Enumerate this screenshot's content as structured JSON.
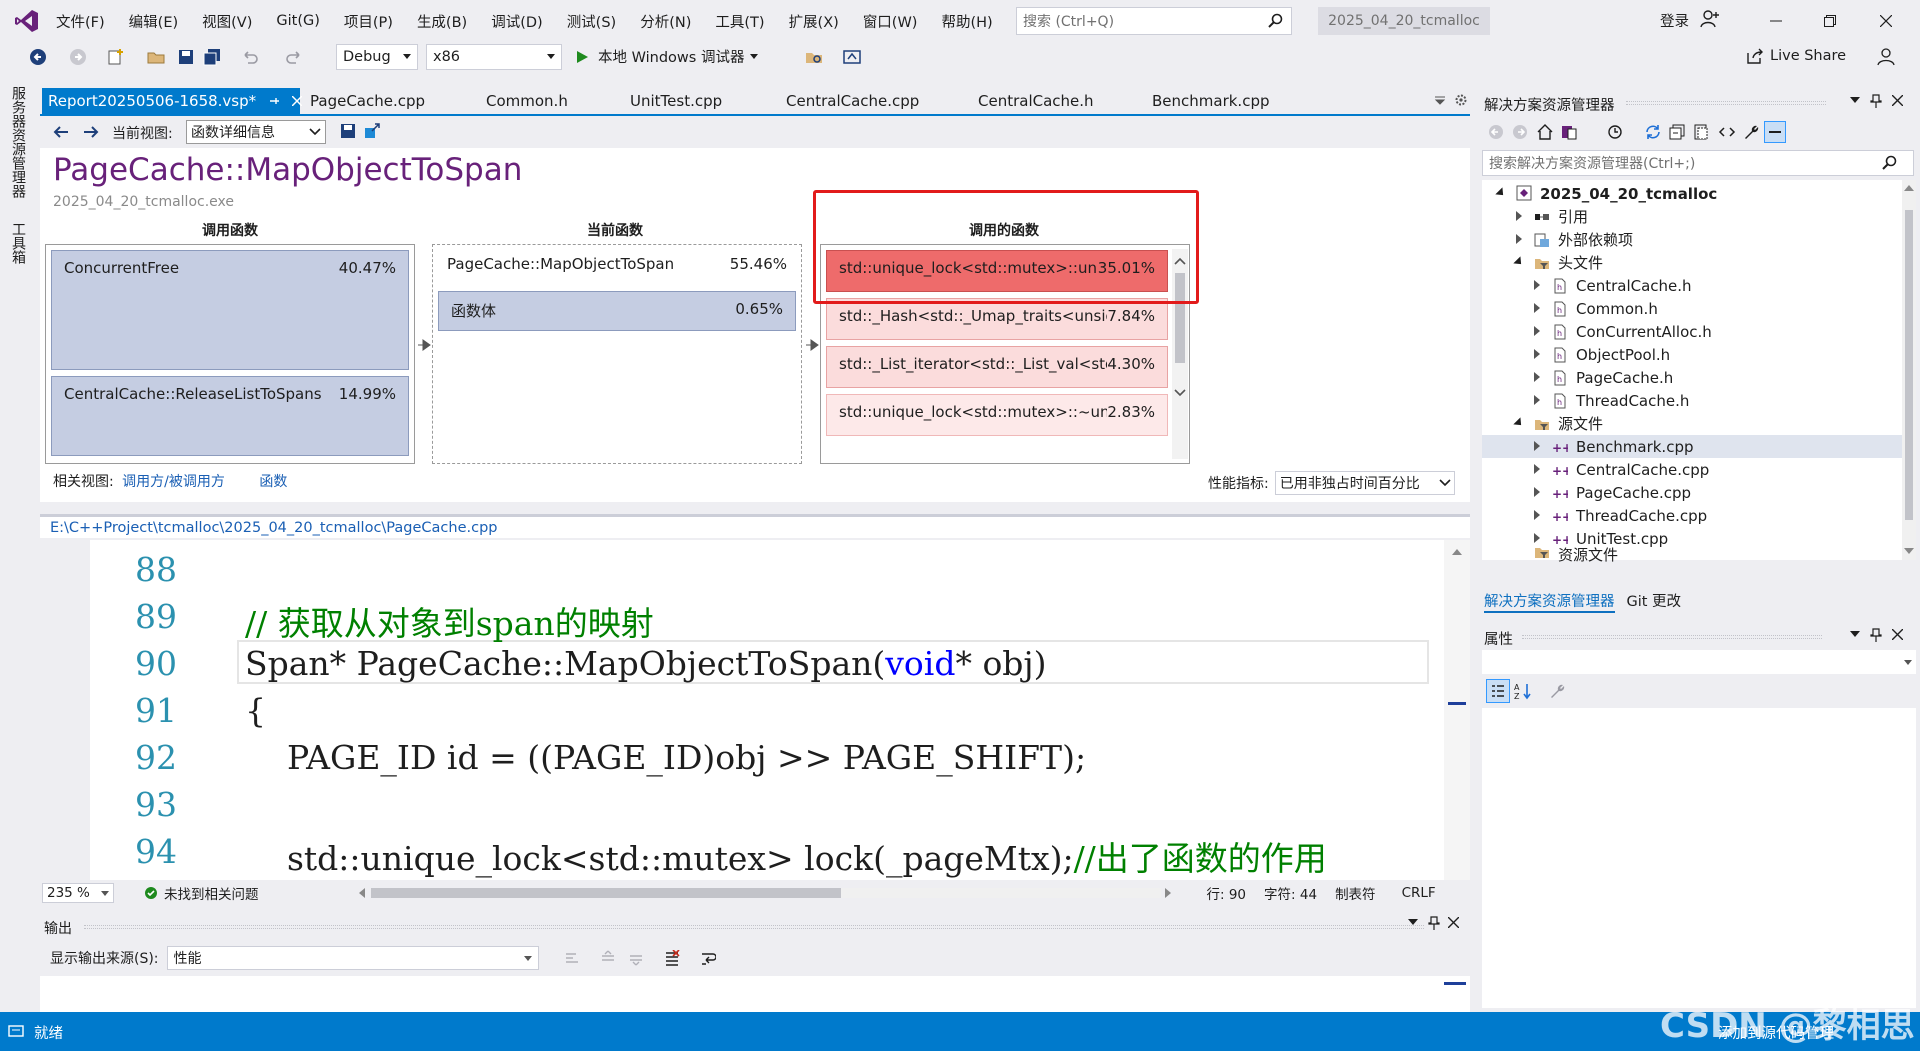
{
  "menubar": {
    "items": [
      "文件(F)",
      "编辑(E)",
      "视图(V)",
      "Git(G)",
      "项目(P)",
      "生成(B)",
      "调试(D)",
      "测试(S)",
      "分析(N)",
      "工具(T)",
      "扩展(X)",
      "窗口(W)",
      "帮助(H)"
    ],
    "search_placeholder": "搜索 (Ctrl+Q)",
    "solution_name": "2025_04_20_tcmalloc",
    "login": "登录"
  },
  "toolbar": {
    "config": "Debug",
    "platform": "x86",
    "debugger": "本地 Windows 调试器",
    "live_share": "Live Share"
  },
  "left_tabs": [
    "服务器资源管理器",
    "工具箱"
  ],
  "doc_tabs": [
    {
      "label": "Report20250506-1658.vsp*",
      "active": true
    },
    {
      "label": "PageCache.cpp"
    },
    {
      "label": "Common.h"
    },
    {
      "label": "UnitTest.cpp"
    },
    {
      "label": "CentralCache.cpp"
    },
    {
      "label": "CentralCache.h"
    },
    {
      "label": "Benchmark.cpp"
    }
  ],
  "report": {
    "current_view_label": "当前视图:",
    "current_view_value": "函数详细信息",
    "title": "PageCache::MapObjectToSpan",
    "exe": "2025_04_20_tcmalloc.exe",
    "callers_header": "调用函数",
    "current_header": "当前函数",
    "callees_header": "调用的函数",
    "callers": [
      {
        "name": "ConcurrentFree",
        "pct": "40.47%"
      },
      {
        "name": "CentralCache::ReleaseListToSpans",
        "pct": "14.99%"
      }
    ],
    "current": [
      {
        "name": "PageCache::MapObjectToSpan",
        "pct": "55.46%"
      },
      {
        "name": "函数体",
        "pct": "0.65%"
      }
    ],
    "callees": [
      {
        "name": "std::unique_lock<std::mutex>::unique_lock<s...",
        "pct": "35.01%"
      },
      {
        "name": "std::_Hash<std::_Umap_traits<unsigned int,Sp...",
        "pct": "7.84%"
      },
      {
        "name": "std::_List_iterator<std::_List_val<std::_List_simpl...",
        "pct": "4.30%"
      },
      {
        "name": "std::unique_lock<std::mutex>::~unique_lock<s...",
        "pct": "2.83%"
      }
    ],
    "related_label": "相关视图:",
    "related_link1": "调用方/被调用方",
    "related_link2": "函数",
    "metric_label": "性能指标:",
    "metric_value": "已用非独占时间百分比"
  },
  "editor": {
    "path": "E:\\C++Project\\tcmalloc\\2025_04_20_tcmalloc\\PageCache.cpp",
    "lines": [
      {
        "no": "88",
        "code": ""
      },
      {
        "no": "89",
        "code": "// 获取从对象到span的映射"
      },
      {
        "no": "90",
        "code_a": "Span* PageCache::MapObjectToSpan(",
        "code_kw": "void",
        "code_b": "* obj)"
      },
      {
        "no": "91",
        "code": "{"
      },
      {
        "no": "92",
        "code": "    PAGE_ID id = ((PAGE_ID)obj >> PAGE_SHIFT);"
      },
      {
        "no": "93",
        "code": ""
      },
      {
        "no": "94",
        "code_a": "    std::unique_lock<std::mutex> lock(_pageMtx);",
        "code_cm": "//出了函数的作用"
      }
    ],
    "zoom": "235 %",
    "issues": "未找到相关问题",
    "row": "行: 90",
    "col": "字符: 44",
    "tabs": "制表符",
    "eol": "CRLF"
  },
  "output": {
    "title": "输出",
    "source_label": "显示输出来源(S):",
    "source_value": "性能"
  },
  "solution_explorer": {
    "title": "解决方案资源管理器",
    "search_placeholder": "搜索解决方案资源管理器(Ctrl+;)",
    "root": "2025_04_20_tcmalloc",
    "nodes": [
      {
        "label": "引用",
        "level": 1
      },
      {
        "label": "外部依赖项",
        "level": 1
      },
      {
        "label": "头文件",
        "level": 1
      },
      {
        "label": "CentralCache.h",
        "level": 2
      },
      {
        "label": "Common.h",
        "level": 2
      },
      {
        "label": "ConCurrentAlloc.h",
        "level": 2
      },
      {
        "label": "ObjectPool.h",
        "level": 2
      },
      {
        "label": "PageCache.h",
        "level": 2
      },
      {
        "label": "ThreadCache.h",
        "level": 2
      },
      {
        "label": "源文件",
        "level": 1
      },
      {
        "label": "Benchmark.cpp",
        "level": 2
      },
      {
        "label": "CentralCache.cpp",
        "level": 2
      },
      {
        "label": "PageCache.cpp",
        "level": 2
      },
      {
        "label": "ThreadCache.cpp",
        "level": 2
      },
      {
        "label": "UnitTest.cpp",
        "level": 2
      },
      {
        "label": "资源文件",
        "level": 1
      }
    ],
    "tab_active": "解决方案资源管理器",
    "tab_git": "Git 更改"
  },
  "properties": {
    "title": "属性"
  },
  "statusbar": {
    "text": "就绪",
    "add_source": "添加到源代码管理"
  },
  "watermark": "CSDN @黎相思",
  "colors": {
    "accent": "#007acc",
    "title_purple": "#68217a",
    "hot_red": "#ee6b6b",
    "highlight_border": "#e21b1b"
  }
}
